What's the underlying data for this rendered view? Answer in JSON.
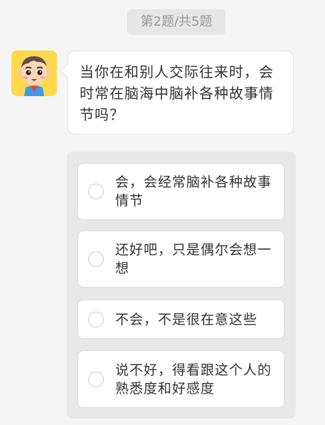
{
  "header": {
    "progress_label": "第2题/共5题"
  },
  "avatar": {
    "icon": "cartoon-boy-avatar-icon",
    "background_color": "#ffd84d"
  },
  "question": {
    "text": "当你在和别人交际往来时，会时常在脑海中脑补各种故事情节吗？"
  },
  "options": [
    {
      "label": "会，会经常脑补各种故事情节",
      "selected": false
    },
    {
      "label": "还好吧，只是偶尔会想一想",
      "selected": false
    },
    {
      "label": "不会，不是很在意这些",
      "selected": false
    },
    {
      "label": "说不好，得看跟这个人的熟悉度和好感度",
      "selected": false
    }
  ]
}
